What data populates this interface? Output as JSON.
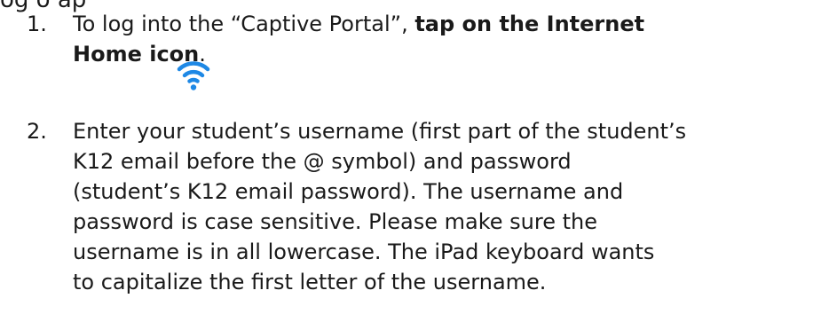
{
  "header_fragment": "og     o     ap",
  "steps": [
    {
      "number": "1.",
      "line1_prefix": "To log into the “Captive Portal”, ",
      "line1_bold": "tap on the Internet",
      "line2_bold": "Home icon",
      "line2_suffix": ".",
      "icon": "wifi-icon"
    },
    {
      "number": "2.",
      "lines": [
        "Enter your student’s username (first part of the student’s",
        "K12 email before the @ symbol) and password",
        "(student’s K12 email password).  The username and",
        "password is case sensitive.  Please make sure the",
        "username is in all lowercase.  The iPad keyboard wants",
        "to capitalize the first letter of the username."
      ]
    }
  ],
  "colors": {
    "icon_accent": "#1e88e5",
    "text": "#1a1a1a"
  }
}
